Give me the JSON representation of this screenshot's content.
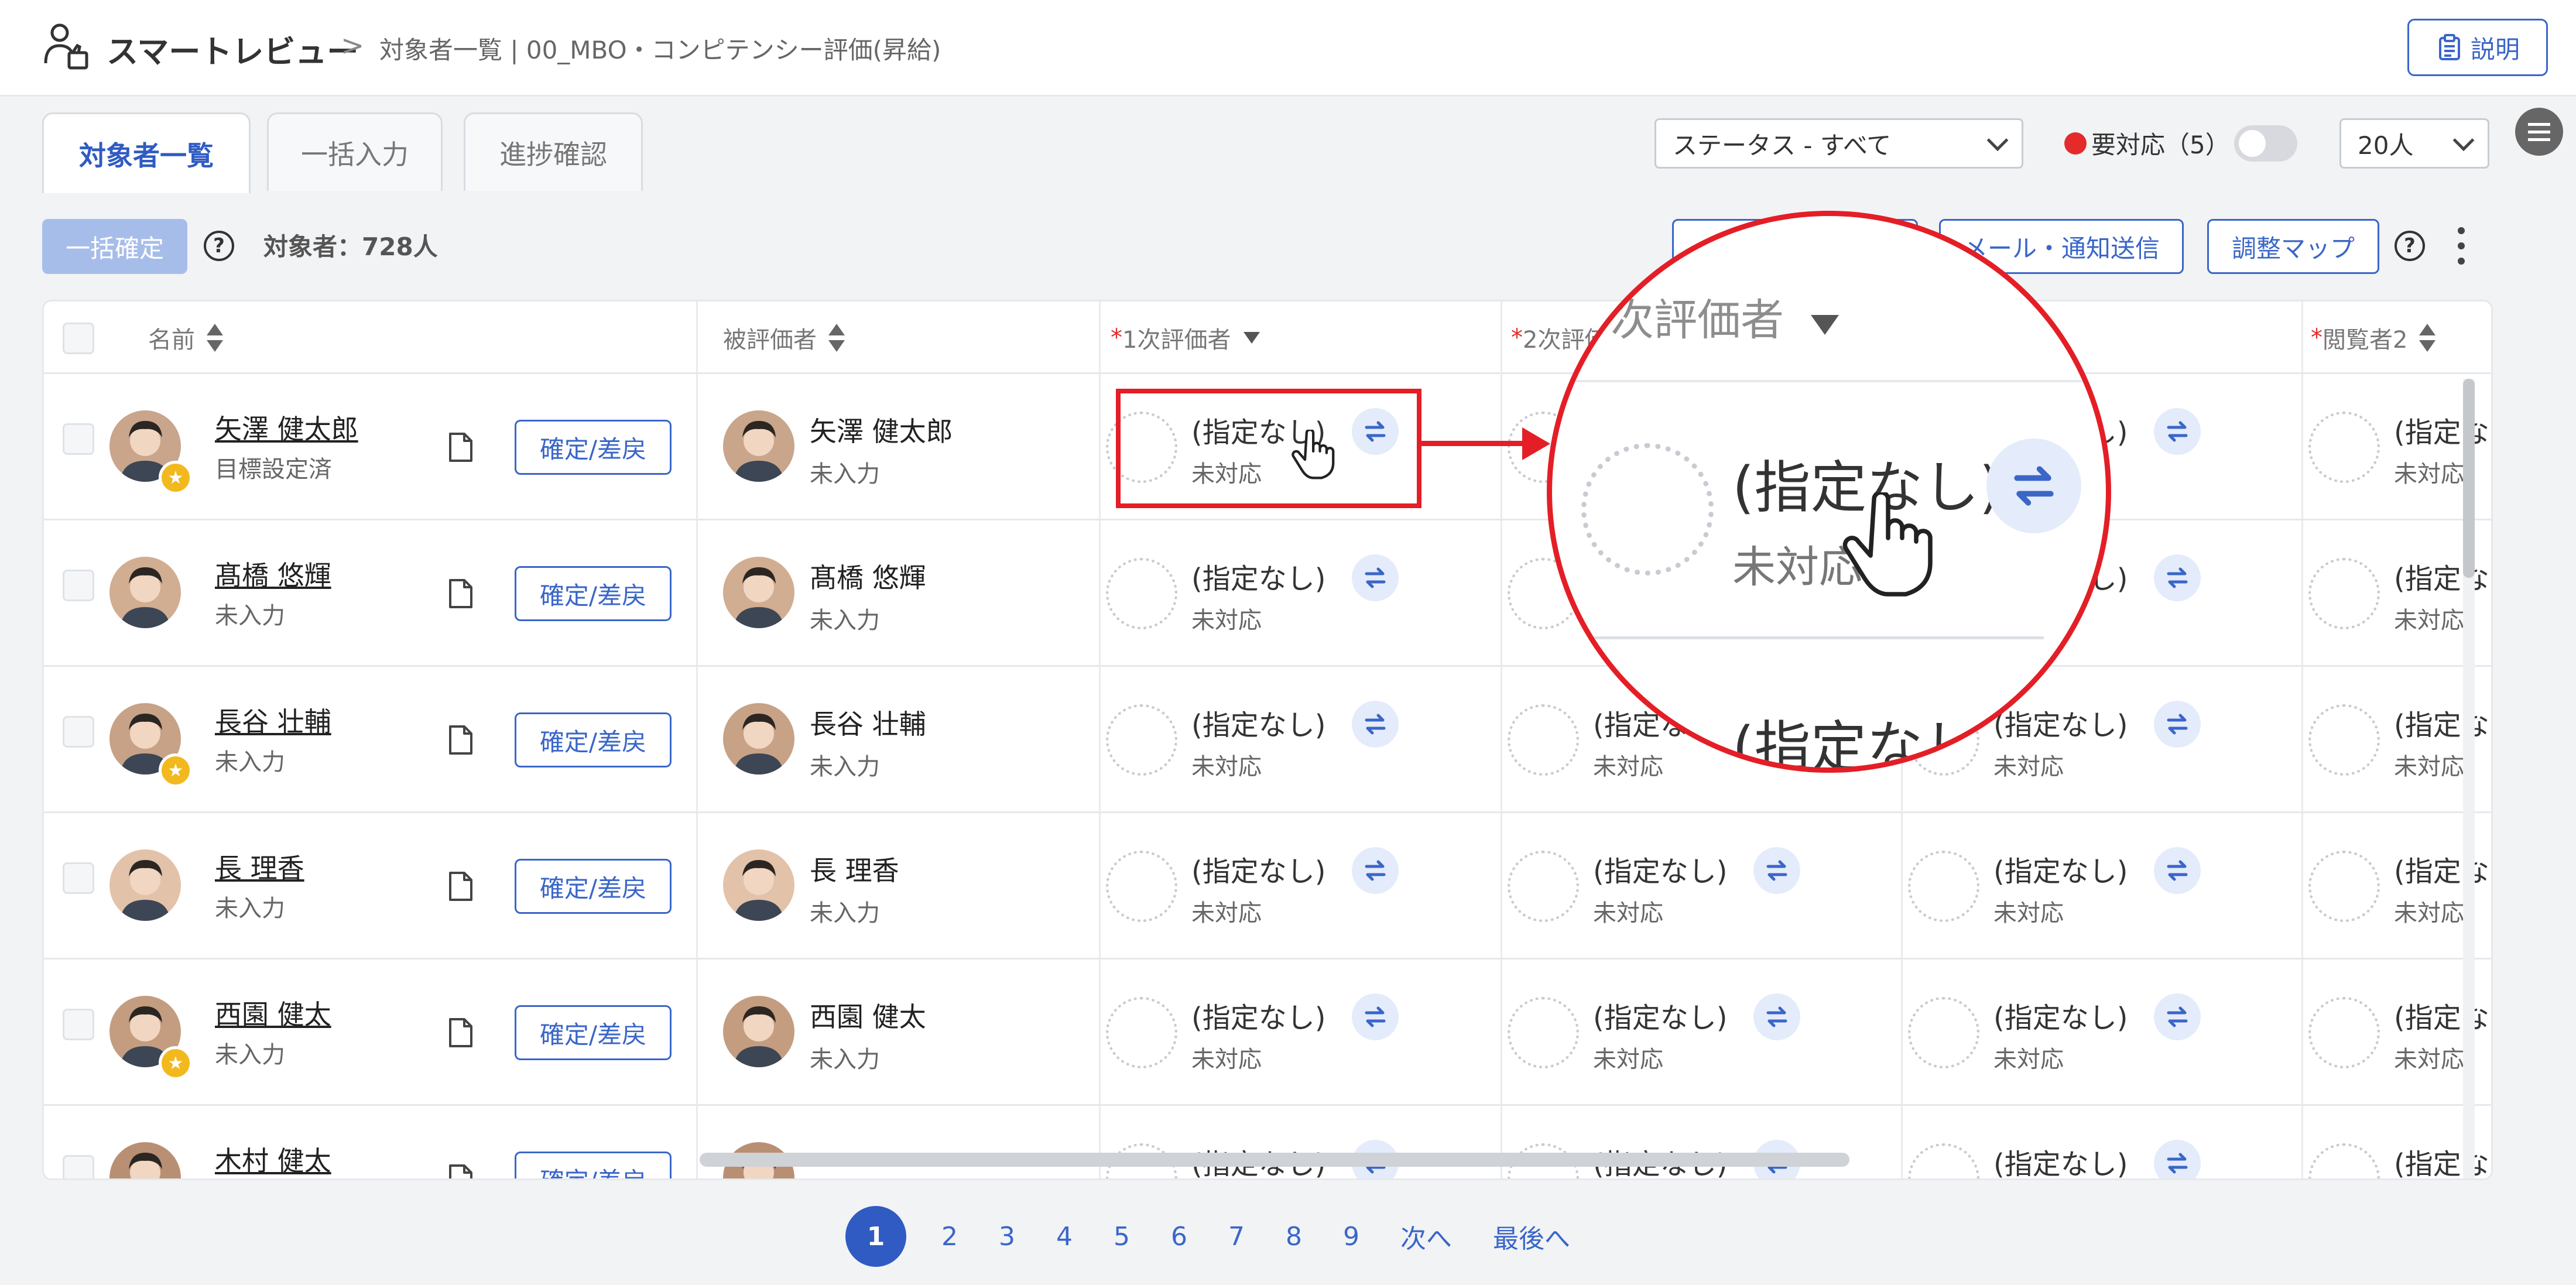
{
  "header": {
    "app_name": "スマートレビュー",
    "breadcrumb": "対象者一覧 | 00_MBO・コンピテンシー評価(昇給)",
    "help_label": "説明",
    "icons": {
      "brand": "user-review-icon",
      "help": "clipboard-icon"
    }
  },
  "tabs": [
    {
      "label": "対象者一覧",
      "active": true
    },
    {
      "label": "一括入力",
      "active": false
    },
    {
      "label": "進捗確認",
      "active": false
    }
  ],
  "filters": {
    "status_select": "ステータス - すべて",
    "needs_action": "要対応（5）",
    "needs_action_toggle": false,
    "page_size": "20人"
  },
  "toolbar": {
    "bulk_confirm": "一括確定",
    "target_count": "対象者：728人",
    "mail_button": "メール・通知送信",
    "adjust_button": "調整マップ"
  },
  "table": {
    "columns": {
      "name": "名前",
      "evaluatee": "被評価者",
      "eval1": "1次評価者",
      "eval2": "2次評価者",
      "viewer2": "閲覧者2",
      "required_mark": "*"
    },
    "confirm_label": "確定/差戻",
    "unassigned": "(指定なし)",
    "not_responded": "未対応",
    "rows": [
      {
        "name": "矢澤 健太郎",
        "status": "目標設定済",
        "evaluatee": "矢澤 健太郎",
        "evaluatee_status": "未入力",
        "star": true
      },
      {
        "name": "髙橋 悠輝",
        "status": "未入力",
        "evaluatee": "髙橋 悠輝",
        "evaluatee_status": "未入力",
        "star": false
      },
      {
        "name": "長谷 壮輔",
        "status": "未入力",
        "evaluatee": "長谷 壮輔",
        "evaluatee_status": "未入力",
        "star": true
      },
      {
        "name": "長 理香",
        "status": "未入力",
        "evaluatee": "長 理香",
        "evaluatee_status": "未入力",
        "star": false
      },
      {
        "name": "西園 健太",
        "status": "未入力",
        "evaluatee": "西園 健太",
        "evaluatee_status": "未入力",
        "star": true
      },
      {
        "name": "木村 健太",
        "status": "",
        "evaluatee": "",
        "evaluatee_status": "",
        "star": false
      }
    ]
  },
  "zoom": {
    "header": "次評価者",
    "value": "(指定なし)",
    "status": "未対応",
    "next_value": "(指定なし)"
  },
  "pagination": {
    "pages": [
      "1",
      "2",
      "3",
      "4",
      "5",
      "6",
      "7",
      "8",
      "9"
    ],
    "current": "1",
    "next": "次へ",
    "last": "最後へ"
  },
  "colors": {
    "accent": "#2f5bc2",
    "highlight": "#e41e26",
    "alert": "#e42a2a",
    "star": "#f2b91f"
  }
}
